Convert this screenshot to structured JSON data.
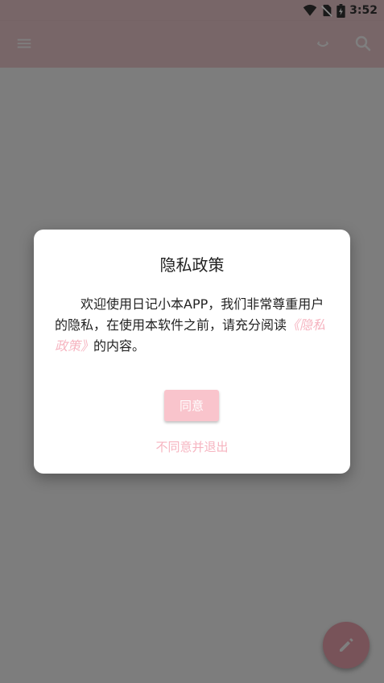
{
  "status_bar": {
    "time": "3:52",
    "icons": [
      "wifi-icon",
      "no-sim-icon",
      "battery-charging-icon"
    ]
  },
  "app_bar": {
    "icons": [
      "menu-icon",
      "mood-icon",
      "search-icon"
    ]
  },
  "dialog": {
    "title": "隐私政策",
    "message_prefix": "欢迎使用日记小本APP，我们非常尊重用户的隐私，在使用本软件之前，请充分阅读",
    "policy_link": "《隐私政策》",
    "message_suffix": "的内容。",
    "agree_label": "同意",
    "disagree_label": "不同意并退出"
  },
  "fab": {
    "icon": "pencil-icon"
  },
  "colors": {
    "accent": "#f1a6b2",
    "bar": "#f1cdd1",
    "link": "#f6b4c0"
  }
}
